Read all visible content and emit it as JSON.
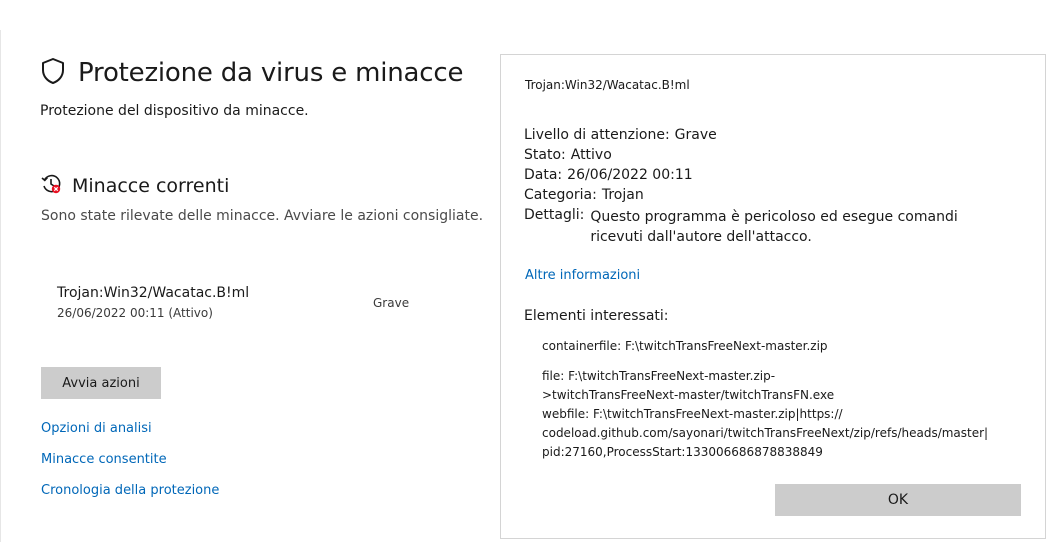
{
  "page": {
    "title": "Protezione da virus e minacce",
    "subtitle": "Protezione del dispositivo da minacce."
  },
  "current_threats": {
    "heading": "Minacce correnti",
    "description": "Sono state rilevate delle minacce. Avviare le azioni consigliate.",
    "items": [
      {
        "name": "Trojan:Win32/Wacatac.B!ml",
        "meta": "26/06/2022 00:11 (Attivo)",
        "severity": "Grave"
      }
    ],
    "start_button": "Avvia azioni"
  },
  "links": {
    "scan_options": "Opzioni di analisi",
    "allowed_threats": "Minacce consentite",
    "protection_history": "Cronologia della protezione"
  },
  "dialog": {
    "title": "Trojan:Win32/Wacatac.B!ml",
    "alert_level_label": "Livello di attenzione:",
    "alert_level_value": "Grave",
    "status_label": "Stato:",
    "status_value": "Attivo",
    "date_label": "Data:",
    "date_value": "26/06/2022 00:11",
    "category_label": "Categoria:",
    "category_value": "Trojan",
    "details_label": "Dettagli:",
    "details_value": "Questo programma è pericoloso ed esegue comandi ricevuti dall'autore dell'attacco.",
    "more_info": "Altre informazioni",
    "affected_label": "Elementi interessati:",
    "affected_items": [
      "containerfile: F:\\twitchTransFreeNext-master.zip",
      "file: F:\\twitchTransFreeNext-master.zip-\n>twitchTransFreeNext-master/twitchTransFN.exe\nwebfile: F:\\twitchTransFreeNext-master.zip|https://\ncodeload.github.com/sayonari/twitchTransFreeNext/zip/refs/heads/master|\npid:27160,ProcessStart:133006686878838849"
    ],
    "ok_button": "OK"
  },
  "icons": {
    "title_icon": "shield-icon",
    "section_icon": "threat-history-icon"
  },
  "colors": {
    "link": "#0067b8",
    "button": "#cccccc",
    "alert_badge": "#e81123"
  }
}
